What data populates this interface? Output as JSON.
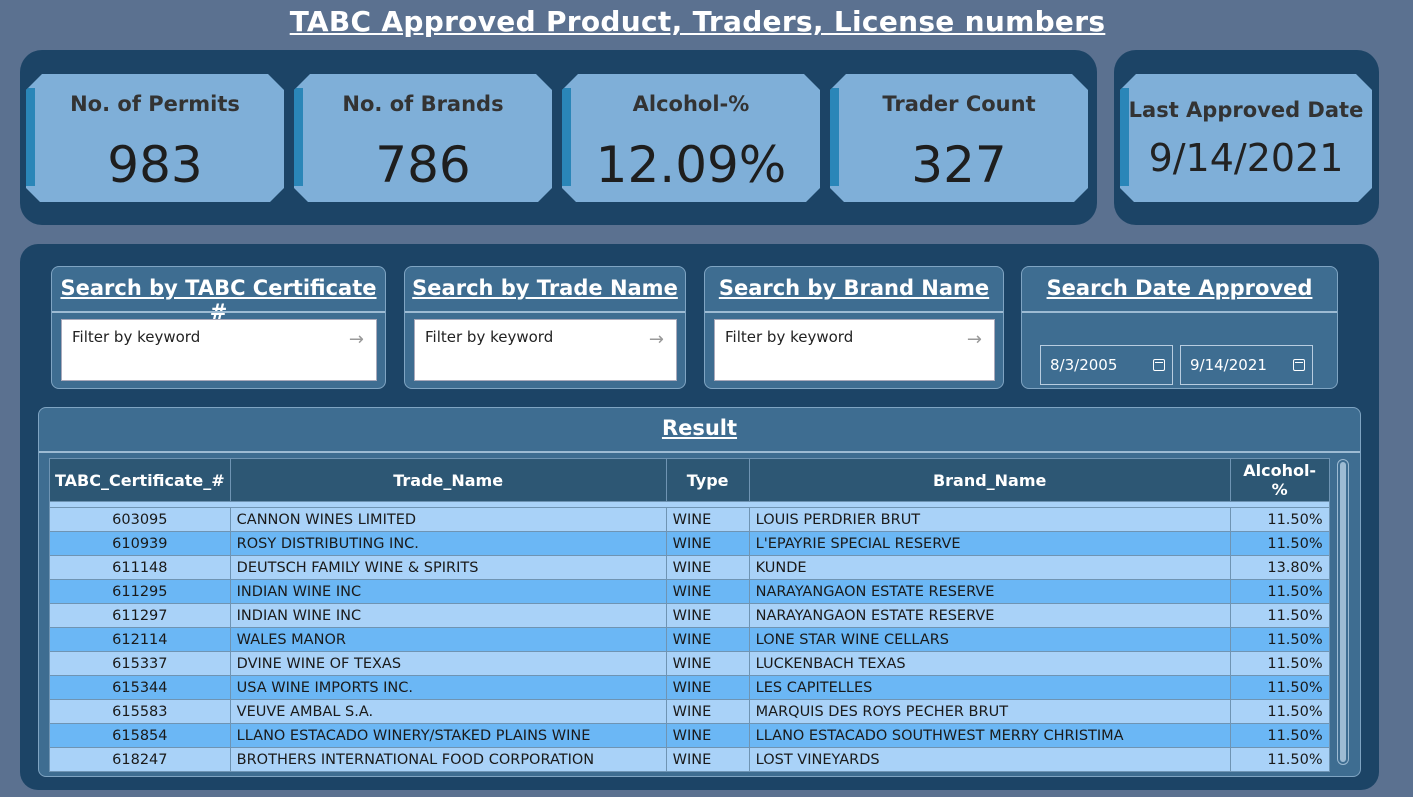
{
  "title": "TABC Approved Product, Traders, License numbers",
  "kpis": [
    {
      "label": "No. of Permits",
      "value": "983"
    },
    {
      "label": "No. of Brands",
      "value": "786"
    },
    {
      "label": "Alcohol-%",
      "value": "12.09%"
    },
    {
      "label": "Trader Count",
      "value": "327"
    }
  ],
  "last_approved": {
    "label": "Last Approved Date",
    "value": "9/14/2021"
  },
  "search": {
    "certificate": {
      "title": "Search by TABC Certificate #",
      "placeholder": "Filter by keyword"
    },
    "trade_name": {
      "title": "Search by Trade Name",
      "placeholder": "Filter by keyword"
    },
    "brand_name": {
      "title": "Search by Brand Name",
      "placeholder": "Filter by keyword"
    },
    "date": {
      "title": "Search Date Approved",
      "start": "8/3/2005",
      "end": "9/14/2021"
    }
  },
  "result": {
    "title": "Result",
    "columns": [
      "TABC_Certificate_#",
      "Trade_Name",
      "Type",
      "Brand_Name",
      "Alcohol-%"
    ],
    "rows": [
      [
        "603095",
        "CANNON WINES LIMITED",
        "WINE",
        "LOUIS PERDRIER BRUT",
        "11.50%"
      ],
      [
        "610939",
        "ROSY DISTRIBUTING INC.",
        "WINE",
        "L'EPAYRIE SPECIAL RESERVE",
        "11.50%"
      ],
      [
        "611148",
        "DEUTSCH FAMILY WINE & SPIRITS",
        "WINE",
        "KUNDE",
        "13.80%"
      ],
      [
        "611295",
        "INDIAN WINE INC",
        "WINE",
        "NARAYANGAON ESTATE RESERVE",
        "11.50%"
      ],
      [
        "611297",
        "INDIAN WINE INC",
        "WINE",
        "NARAYANGAON ESTATE RESERVE",
        "11.50%"
      ],
      [
        "612114",
        "WALES MANOR",
        "WINE",
        "LONE STAR WINE CELLARS",
        "11.50%"
      ],
      [
        "615337",
        "DVINE WINE OF TEXAS",
        "WINE",
        "LUCKENBACH TEXAS",
        "11.50%"
      ],
      [
        "615344",
        "USA WINE IMPORTS INC.",
        "WINE",
        "LES CAPITELLES",
        "11.50%"
      ],
      [
        "615583",
        "VEUVE AMBAL S.A.",
        "WINE",
        "MARQUIS DES ROYS PECHER BRUT",
        "11.50%"
      ],
      [
        "615854",
        "LLANO ESTACADO WINERY/STAKED PLAINS WINE",
        "WINE",
        "LLANO ESTACADO SOUTHWEST MERRY CHRISTIMA",
        "11.50%"
      ],
      [
        "618247",
        "BROTHERS INTERNATIONAL FOOD CORPORATION",
        "WINE",
        "LOST VINEYARDS",
        "11.50%"
      ]
    ]
  }
}
